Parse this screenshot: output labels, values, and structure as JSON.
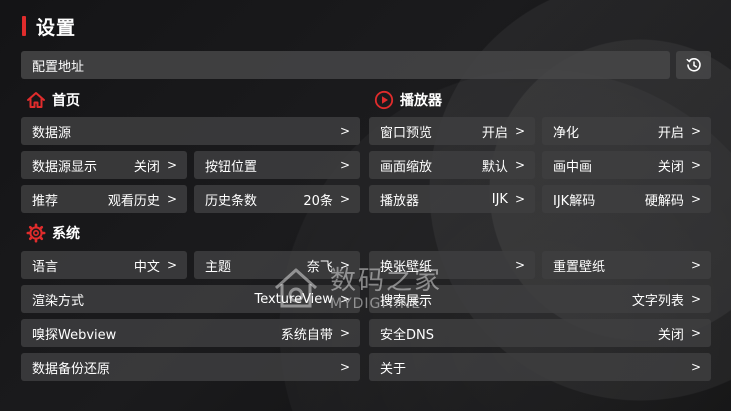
{
  "header": {
    "title": "设置"
  },
  "config_address": {
    "label": "配置地址"
  },
  "sections": {
    "home": "首页",
    "player": "播放器",
    "system": "系统"
  },
  "chevron": ">",
  "cells": {
    "data_source": {
      "label": "数据源",
      "value": ""
    },
    "data_source_display": {
      "label": "数据源显示",
      "value": "关闭"
    },
    "button_position": {
      "label": "按钮位置",
      "value": ""
    },
    "recommend": {
      "label": "推荐",
      "value": "观看历史"
    },
    "history_count": {
      "label": "历史条数",
      "value": "20条"
    },
    "window_preview": {
      "label": "窗口预览",
      "value": "开启"
    },
    "purify": {
      "label": "净化",
      "value": "开启"
    },
    "screen_scale": {
      "label": "画面缩放",
      "value": "默认"
    },
    "pip": {
      "label": "画中画",
      "value": "关闭"
    },
    "player": {
      "label": "播放器",
      "value": "IJK"
    },
    "ijk_decode": {
      "label": "IJK解码",
      "value": "硬解码"
    },
    "language": {
      "label": "语言",
      "value": "中文"
    },
    "theme": {
      "label": "主题",
      "value": "奈飞"
    },
    "change_wallpaper": {
      "label": "换张壁纸",
      "value": ""
    },
    "reset_wallpaper": {
      "label": "重置壁纸",
      "value": ""
    },
    "render_mode": {
      "label": "渲染方式",
      "value": "TextureView"
    },
    "search_display": {
      "label": "搜索展示",
      "value": "文字列表"
    },
    "sniff_webview": {
      "label": "嗅探Webview",
      "value": "系统自带"
    },
    "secure_dns": {
      "label": "安全DNS",
      "value": "关闭"
    },
    "backup_restore": {
      "label": "数据备份还原",
      "value": ""
    },
    "about": {
      "label": "关于",
      "value": ""
    }
  },
  "watermark": {
    "main": "数码之家",
    "sub": "MYDIGIT.NET"
  },
  "colors": {
    "accent": "#e02c2c",
    "cell_bg": "#3e3e40",
    "background": "#121213"
  }
}
